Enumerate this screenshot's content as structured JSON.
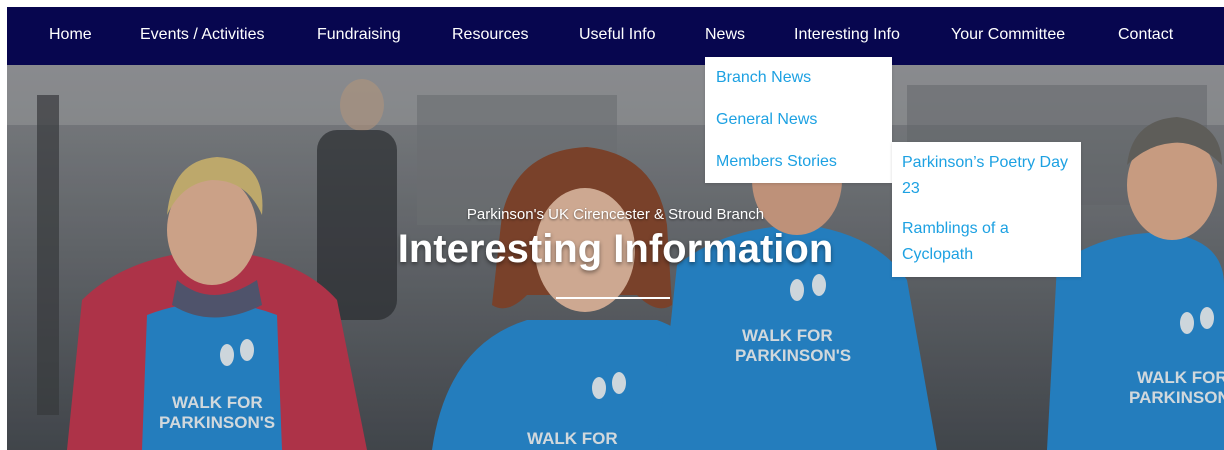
{
  "nav": {
    "items": [
      {
        "label": "Home"
      },
      {
        "label": "Events / Activities"
      },
      {
        "label": "Fundraising"
      },
      {
        "label": "Resources"
      },
      {
        "label": "Useful Info"
      },
      {
        "label": "News"
      },
      {
        "label": "Interesting Info"
      },
      {
        "label": "Your Committee"
      },
      {
        "label": "Contact"
      }
    ]
  },
  "dropdown": {
    "items": [
      {
        "label": "Branch News"
      },
      {
        "label": "General News"
      },
      {
        "label": "Members Stories"
      }
    ],
    "submenu": {
      "items": [
        {
          "label": "Parkinson’s Poetry Day 23"
        },
        {
          "label": "Ramblings of a Cyclopath"
        }
      ]
    }
  },
  "hero": {
    "subtitle": "Parkinson's UK Cirencester & Stroud Branch",
    "title": "Interesting Information",
    "shirt_text_line1": "WALK FOR",
    "shirt_text_line2": "PARKINSON'S"
  },
  "colors": {
    "nav_bg": "#07064f",
    "nav_text": "#ffffff",
    "dropdown_link": "#1da1e2",
    "shirt_blue": "#2a8fd8"
  }
}
